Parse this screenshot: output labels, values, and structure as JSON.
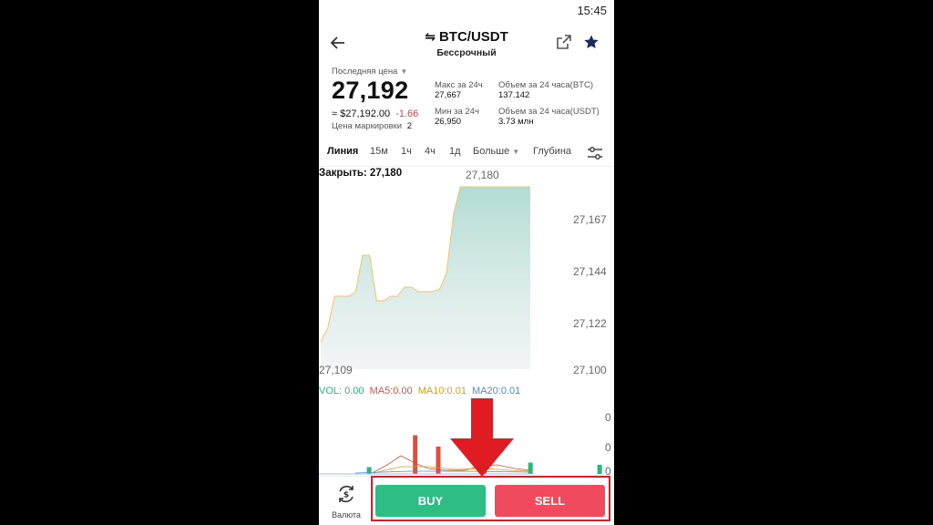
{
  "status": {
    "time": "15:45"
  },
  "header": {
    "back_icon": "arrow-left-icon",
    "swap_icon": "swap-icon",
    "pair": "BTC/USDT",
    "subtitle": "Бессрочный",
    "share_icon": "share-icon",
    "favorite_icon": "star-icon"
  },
  "ticker": {
    "last_price_label": "Последняя цена",
    "last_price": "27,192",
    "usd_price": "≈ $27,192.00",
    "change": "-1.66",
    "mark_label": "Цена маркировки",
    "mark_value": "2",
    "high_label": "Макс за 24ч",
    "high_value": "27,667",
    "low_label": "Мин за 24ч",
    "low_value": "26,950",
    "vol_btc_label": "Объем за 24 часа(BTC)",
    "vol_btc_value": "137.142",
    "vol_usdt_label": "Объем за 24 часа(USDT)",
    "vol_usdt_value": "3.73 млн"
  },
  "tabs": [
    "Линия",
    "15м",
    "1ч",
    "4ч",
    "1д",
    "Больше",
    "Глубина"
  ],
  "active_tab": "Линия",
  "colors": {
    "buy": "#2ebd85",
    "sell": "#f04a5e",
    "line": "#f0c36d",
    "area": "#a9d8cf",
    "vol": "#2bb673",
    "ma5": "#e04e39",
    "ma10": "#d4a018",
    "ma20": "#4a8bd6"
  },
  "chart_data": {
    "type": "area",
    "title": "Закрыть: 27,180",
    "x": [
      0,
      1,
      2,
      3,
      4,
      5,
      6,
      7,
      8,
      9,
      10,
      11,
      12,
      13,
      14,
      15,
      16,
      17,
      18,
      19,
      20,
      21,
      22,
      23,
      24,
      25,
      26,
      27,
      28,
      29,
      30
    ],
    "values": [
      27112,
      27118,
      27132,
      27132,
      27132,
      27134,
      27150,
      27150,
      27130,
      27130,
      27132,
      27132,
      27136,
      27136,
      27134,
      27134,
      27134,
      27135,
      27142,
      27168,
      27180,
      27180,
      27180,
      27180,
      27180,
      27180,
      27180,
      27180,
      27180,
      27180,
      27180
    ],
    "ylim": [
      27100,
      27180
    ],
    "y_ticks": [
      "27,167",
      "27,144",
      "27,122",
      "27,100"
    ],
    "max_label": "27,180",
    "min_label": "27,109",
    "volume": {
      "indicators": {
        "vol": "VOL: 0.00",
        "ma5": "MA5:0.00",
        "ma10": "MA10:0.01",
        "ma20": "MA20:0.01"
      },
      "y_ticks": [
        "0",
        "0",
        "0"
      ],
      "bars": [
        {
          "i": 2,
          "h": 0.15,
          "c": "green"
        },
        {
          "i": 4,
          "h": 0.85,
          "c": "red"
        },
        {
          "i": 5,
          "h": 0.6,
          "c": "red"
        },
        {
          "i": 7,
          "h": 0.35,
          "c": "green"
        },
        {
          "i": 9,
          "h": 0.25,
          "c": "green"
        },
        {
          "i": 12,
          "h": 0.2,
          "c": "green"
        },
        {
          "i": 19,
          "h": 0.45,
          "c": "green"
        },
        {
          "i": 20,
          "h": 0.3,
          "c": "green"
        }
      ]
    }
  },
  "bottom": {
    "currency_icon": "currency-swap-icon",
    "currency_label": "Валюта",
    "buy_label": "BUY",
    "sell_label": "SELL"
  }
}
